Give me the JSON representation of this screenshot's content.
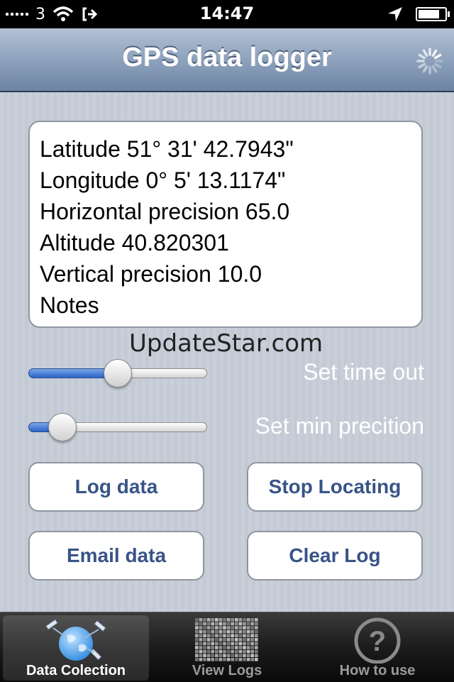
{
  "status_bar": {
    "carrier": "3",
    "time": "14:47",
    "battery_level": 0.9,
    "icons": [
      "signal-icon",
      "wifi-icon",
      "call-forward-icon",
      "location-arrow-icon",
      "battery-icon"
    ]
  },
  "nav": {
    "title": "GPS data logger",
    "spinner_icon": "activity-spinner-icon"
  },
  "info": {
    "lines": [
      "Latitude 51° 31' 42.7943\"",
      "Longitude 0° 5' 13.1174\"",
      "Horizontal precision 65.0",
      "Altitude 40.820301",
      "Vertical precision 10.0",
      "Notes"
    ]
  },
  "watermark": "UpdateStar.com",
  "sliders": [
    {
      "label": "Set time out",
      "value": 0.5
    },
    {
      "label": "Set min precition",
      "value": 0.13
    }
  ],
  "buttons": {
    "log_data": "Log data",
    "stop_locating": "Stop Locating",
    "email_data": "Email data",
    "clear_log": "Clear Log"
  },
  "tabs": [
    {
      "label": "Data Colection",
      "icon": "globe-satellite-icon",
      "selected": true
    },
    {
      "label": "View Logs",
      "icon": "log-list-icon",
      "selected": false
    },
    {
      "label": "How to use",
      "icon": "question-icon",
      "selected": false
    }
  ],
  "colors": {
    "button_text": "#385487",
    "slider_fill": "#2a63c9",
    "nav_bar": "#8ea2bd"
  }
}
